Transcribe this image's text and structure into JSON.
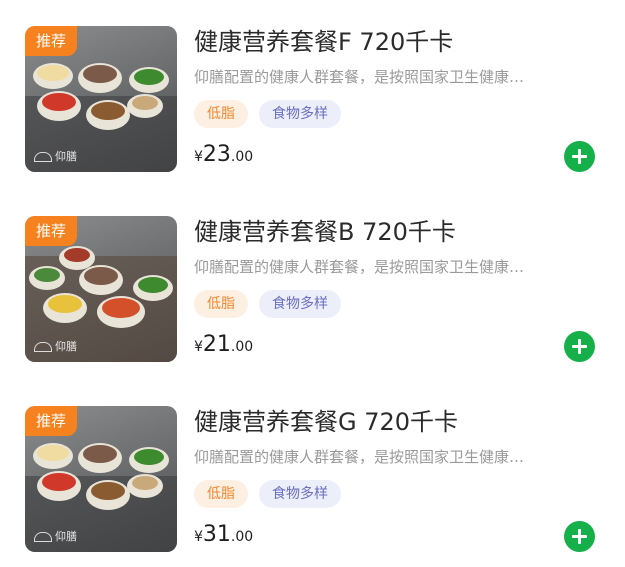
{
  "meals": [
    {
      "badge": "推荐",
      "brand": "仰膳",
      "title": "健康营养套餐F 720千卡",
      "description": "仰膳配置的健康人群套餐，是按照国家卫生健康…",
      "tags": [
        "低脂",
        "食物多样"
      ],
      "price": {
        "currency": "¥",
        "integer": "23",
        "decimal": ".00"
      },
      "add_icon": "plus-icon"
    },
    {
      "badge": "推荐",
      "brand": "仰膳",
      "title": "健康营养套餐B 720千卡",
      "description": "仰膳配置的健康人群套餐，是按照国家卫生健康…",
      "tags": [
        "低脂",
        "食物多样"
      ],
      "price": {
        "currency": "¥",
        "integer": "21",
        "decimal": ".00"
      },
      "add_icon": "plus-icon"
    },
    {
      "badge": "推荐",
      "brand": "仰膳",
      "title": "健康营养套餐G 720千卡",
      "description": "仰膳配置的健康人群套餐，是按照国家卫生健康…",
      "tags": [
        "低脂",
        "食物多样"
      ],
      "price": {
        "currency": "¥",
        "integer": "31",
        "decimal": ".00"
      },
      "add_icon": "plus-icon"
    }
  ],
  "colors": {
    "badge": "#f5821f",
    "add_button": "#16b04a",
    "tag_orange_bg": "#fdefe2",
    "tag_orange_text": "#f08a34",
    "tag_blue_bg": "#eceef9",
    "tag_blue_text": "#6a6fbf"
  }
}
